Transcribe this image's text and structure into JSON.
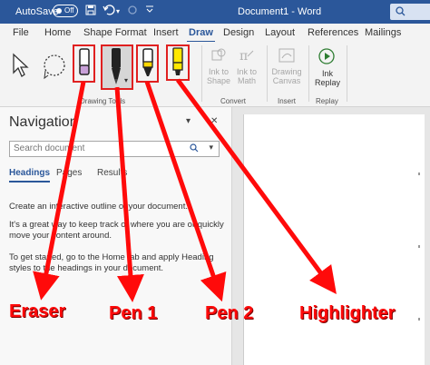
{
  "titlebar": {
    "autosave_label": "AutoSave",
    "autosave_state": "Off",
    "doc_title": "Document1  -  Word",
    "quick_access": [
      "save-icon",
      "undo-icon",
      "redo-icon",
      "customize-icon"
    ]
  },
  "tabs": [
    {
      "label": "File"
    },
    {
      "label": "Home"
    },
    {
      "label": "Shape Format"
    },
    {
      "label": "Insert"
    },
    {
      "label": "Draw",
      "active": true
    },
    {
      "label": "Design"
    },
    {
      "label": "Layout"
    },
    {
      "label": "References"
    },
    {
      "label": "Mailings"
    }
  ],
  "ribbon": {
    "groups": {
      "drawing_tools": "Drawing Tools",
      "convert": "Convert",
      "insert": "Insert",
      "replay": "Replay"
    },
    "buttons": {
      "ink_to_shape": "Ink to Shape",
      "ink_to_math": "Ink to Math",
      "drawing_canvas": "Drawing Canvas",
      "ink_replay": "Ink Replay"
    },
    "colors": {
      "eraser_tip": "#c8a0d8",
      "pen1": "#222222",
      "pen2_tip": "#ffd800",
      "highlighter": "#ffe800",
      "annotation_red": "#ff0a0a"
    }
  },
  "nav": {
    "title": "Navigation",
    "search_placeholder": "Search document",
    "tabs": [
      "Headings",
      "Pages",
      "Results"
    ],
    "para1": "Create an interactive outline of your document.",
    "para2": "It's a great way to keep track of where you are or quickly move your content around.",
    "para3": "To get started, go to the Home tab and apply Heading styles to the headings in your document."
  },
  "annotations": {
    "eraser": "Eraser",
    "pen1": "Pen 1",
    "pen2": "Pen 2",
    "highlighter": "Highlighter"
  }
}
